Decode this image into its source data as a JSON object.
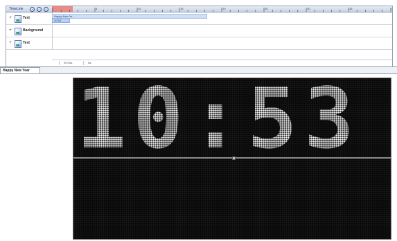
{
  "timeline": {
    "title": "TimeLine",
    "buttons": [
      "+",
      "−",
      "+"
    ],
    "ruler_ticks": [
      "5",
      "10",
      "15",
      "20",
      "25",
      "30",
      "35",
      "40"
    ],
    "tracks": [
      {
        "name": "Text",
        "clips": [
          "Happy New Ye...",
          "10:53"
        ]
      },
      {
        "name": "Background",
        "clips": []
      },
      {
        "name": "Text",
        "clips": []
      }
    ],
    "status": {
      "time": "20.04s.",
      "offset": "0s."
    }
  },
  "document_tab": {
    "label": "Happy New Year"
  },
  "display": {
    "text": "10:53",
    "background": "#060606",
    "led_color": "#f2f2f2"
  },
  "colors": {
    "playhead": "#e88c88",
    "clip": "#cfe0f6",
    "header": "#c8d3e2"
  }
}
